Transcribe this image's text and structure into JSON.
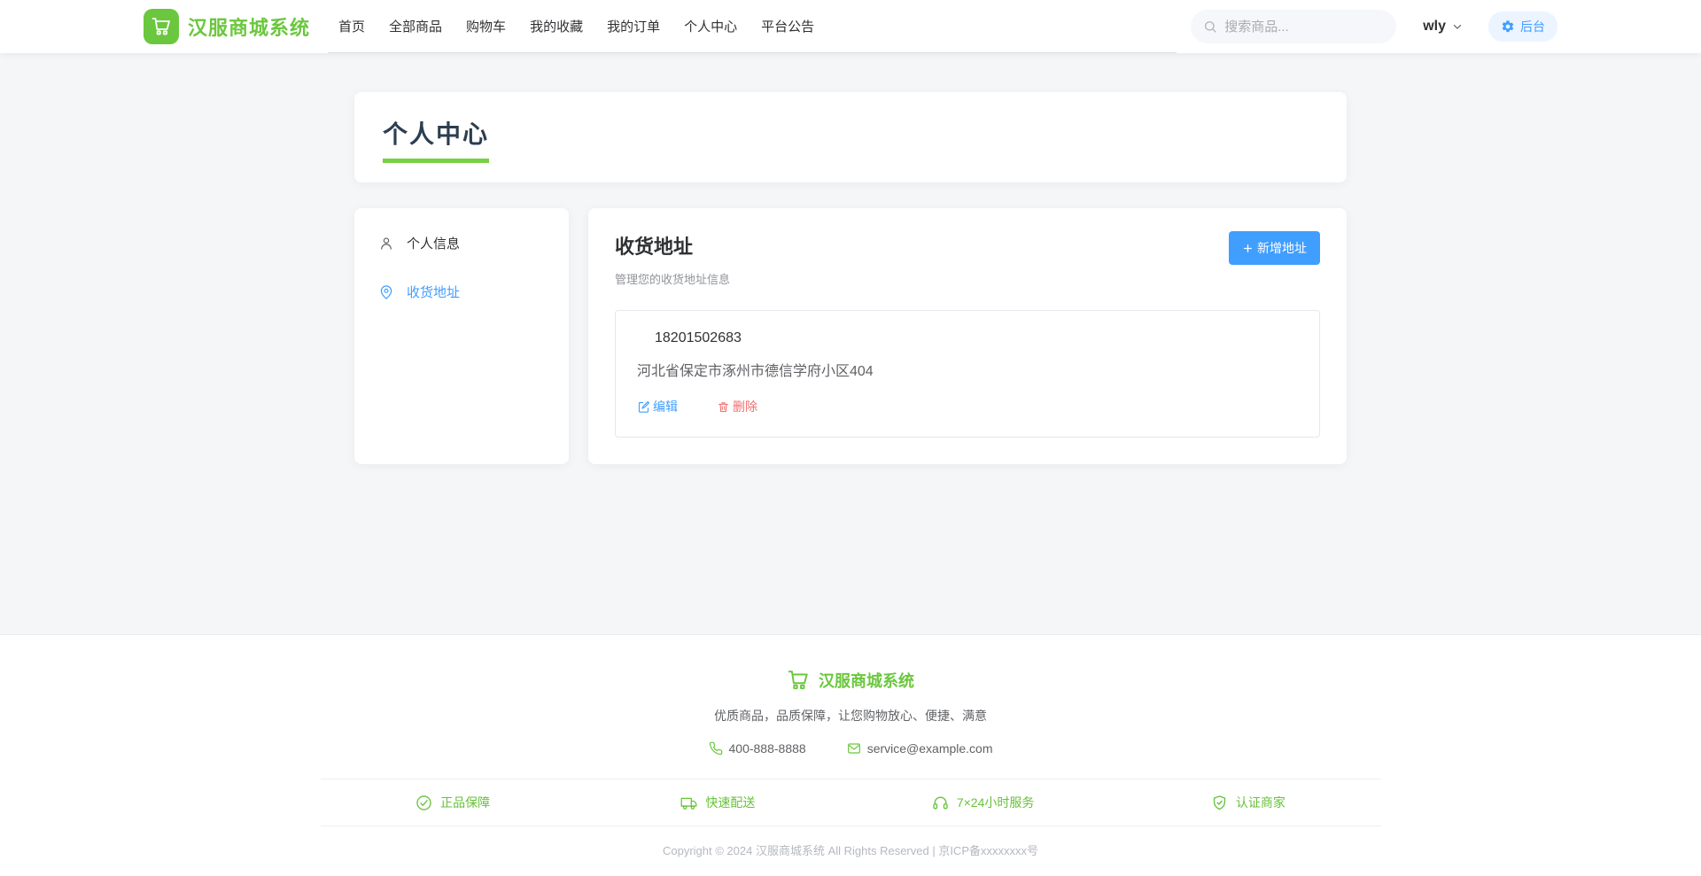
{
  "nav": {
    "brand": "汉服商城系统",
    "items": [
      "首页",
      "全部商品",
      "购物车",
      "我的收藏",
      "我的订单",
      "个人中心",
      "平台公告"
    ],
    "search_placeholder": "搜索商品...",
    "username": "wly",
    "admin_label": "后台"
  },
  "page": {
    "title": "个人中心"
  },
  "sidebar": {
    "items": [
      {
        "label": "个人信息",
        "icon": "user-icon"
      },
      {
        "label": "收货地址",
        "icon": "location-icon"
      }
    ]
  },
  "address_section": {
    "title": "收货地址",
    "subtitle": "管理您的收货地址信息",
    "add_button": "新增地址",
    "addresses": [
      {
        "phone": "18201502683",
        "address": "河北省保定市涿州市德信学府小区404",
        "edit_label": "编辑",
        "delete_label": "删除"
      }
    ]
  },
  "footer": {
    "brand": "汉服商城系统",
    "tagline": "优质商品，品质保障，让您购物放心、便捷、满意",
    "phone": "400-888-8888",
    "email": "service@example.com",
    "features": [
      {
        "label": "正品保障",
        "icon": "check-circle-icon"
      },
      {
        "label": "快速配送",
        "icon": "truck-icon"
      },
      {
        "label": "7×24小时服务",
        "icon": "headset-icon"
      },
      {
        "label": "认证商家",
        "icon": "certified-merchant-icon"
      }
    ],
    "copyright": "Copyright © 2024 汉服商城系统 All Rights Reserved | 京ICP备xxxxxxxx号"
  },
  "colors": {
    "brand_green": "#6bc73e",
    "title_underline_green": "#78d144",
    "primary_blue": "#409eff",
    "danger_red": "#f56c6c",
    "admin_pill_bg": "#ecf5ff"
  }
}
